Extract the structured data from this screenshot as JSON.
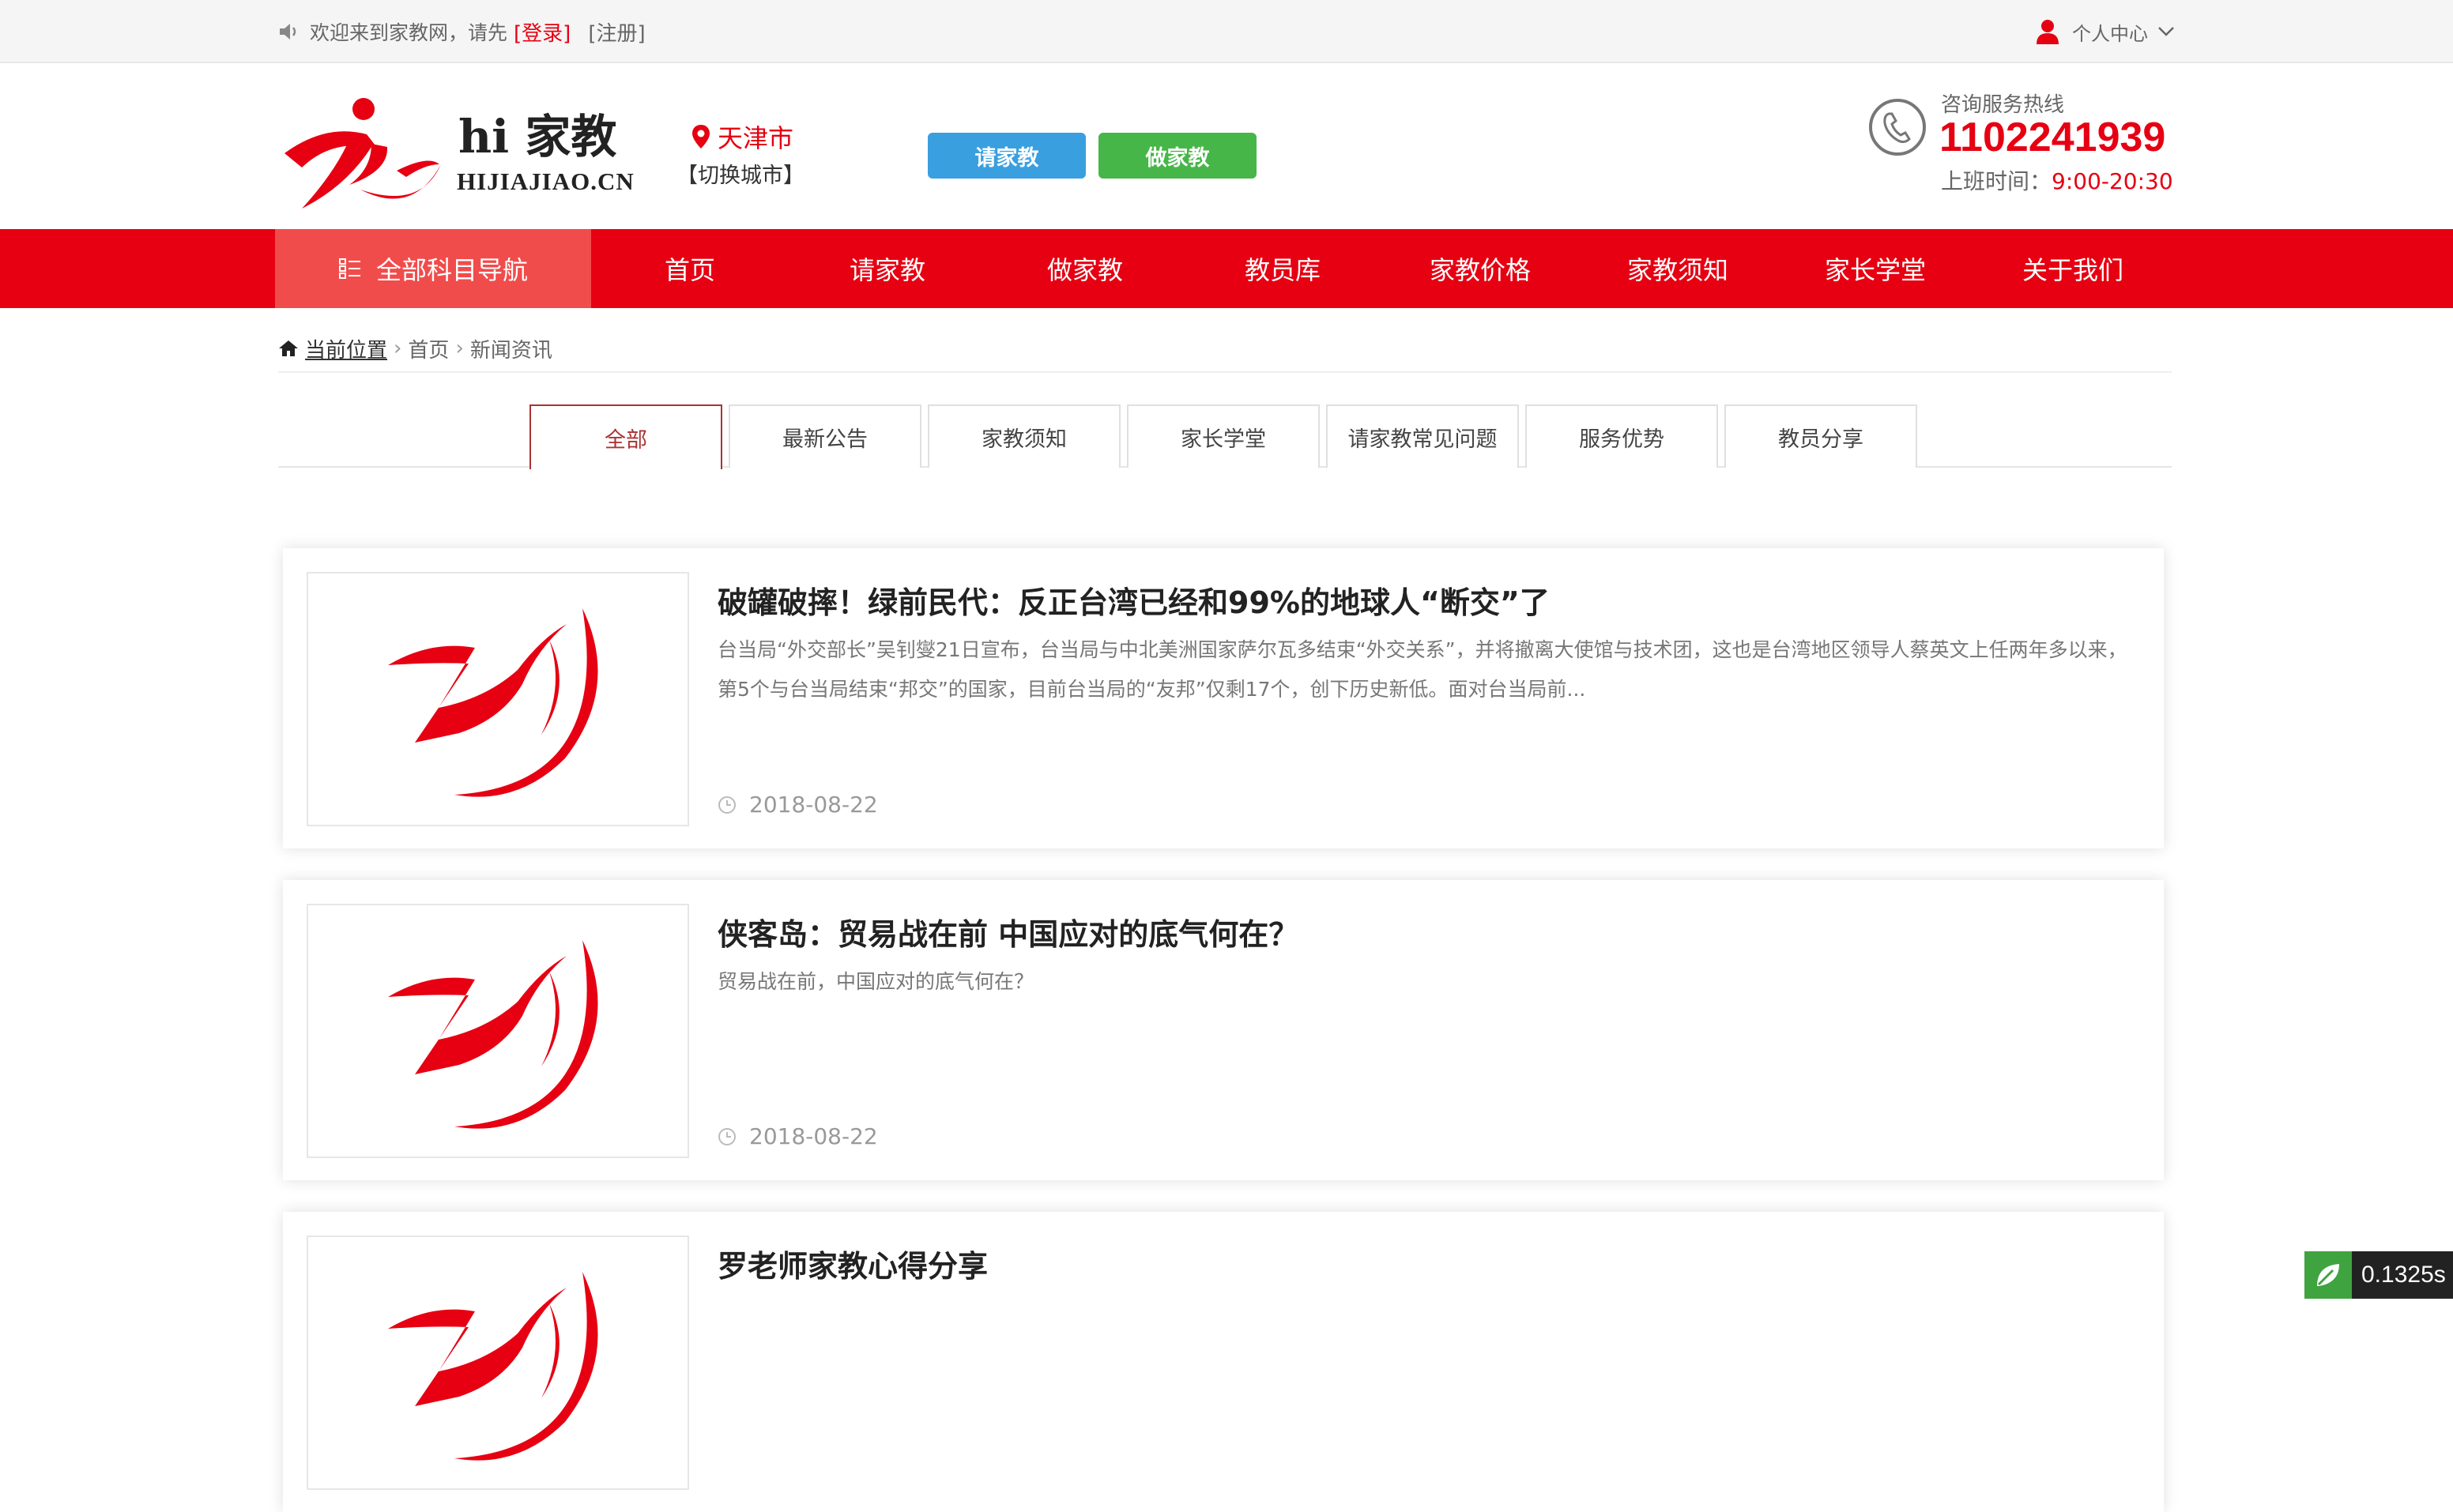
{
  "topbar": {
    "welcome": "欢迎来到家教网，请先",
    "login": "[登录]",
    "register": "[注册]",
    "user_center": "个人中心"
  },
  "header": {
    "brand": "hi 家教",
    "domain": "HIJIAJIAO.CN",
    "city": "天津市",
    "switch_city": "【切换城市】",
    "btn_hire": "请家教",
    "btn_tutor": "做家教",
    "hotline_label": "咨询服务热线",
    "hotline_number": "1102241939",
    "hours_label": "上班时间：",
    "hours_value": "9:00-20:30"
  },
  "nav": {
    "all_subjects": "全部科目导航",
    "items": [
      "首页",
      "请家教",
      "做家教",
      "教员库",
      "家教价格",
      "家教须知",
      "家长学堂",
      "关于我们"
    ]
  },
  "breadcrumb": {
    "current": "当前位置",
    "home": "首页",
    "section": "新闻资讯"
  },
  "tabs": [
    "全部",
    "最新公告",
    "家教须知",
    "家长学堂",
    "请家教常见问题",
    "服务优势",
    "教员分享"
  ],
  "articles": [
    {
      "title": "破罐破摔！绿前民代：反正台湾已经和99%的地球人“断交”了",
      "summary": "台当局“外交部长”吴钊燮21日宣布，台当局与中北美洲国家萨尔瓦多结束“外交关系”，并将撤离大使馆与技术团，这也是台湾地区领导人蔡英文上任两年多以来，第5个与台当局结束“邦交”的国家，目前台当局的“友邦”仅剩17个，创下历史新低。面对台当局前...",
      "date": "2018-08-22"
    },
    {
      "title": "侠客岛：贸易战在前 中国应对的底气何在？",
      "summary": "贸易战在前，中国应对的底气何在？",
      "date": "2018-08-22"
    },
    {
      "title": "罗老师家教心得分享",
      "summary": "",
      "date": ""
    }
  ],
  "timer": "0.1325s",
  "colors": {
    "brand_red": "#e60012",
    "nav_active": "#f14c4c",
    "btn_blue": "#3a9fdf",
    "btn_green": "#46b648"
  }
}
